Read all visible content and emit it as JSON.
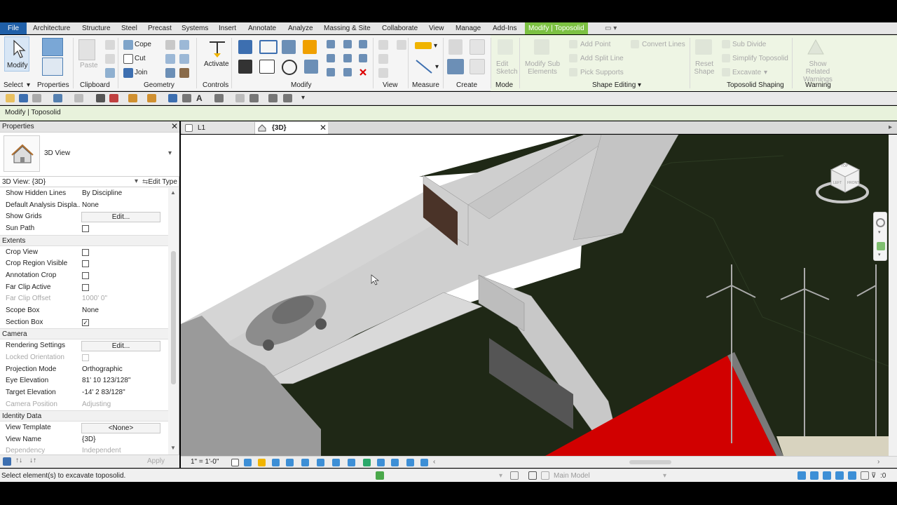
{
  "tabs": [
    "File",
    "Architecture",
    "Structure",
    "Steel",
    "Precast",
    "Systems",
    "Insert",
    "Annotate",
    "Analyze",
    "Massing & Site",
    "Collaborate",
    "View",
    "Manage",
    "Add-Ins",
    "Modify | Toposolid"
  ],
  "ribbon": {
    "modify_label": "Modify",
    "select_label": "Select",
    "properties_label": "Properties",
    "clipboard_label": "Clipboard",
    "paste_label": "Paste",
    "cope_label": "Cope",
    "cut_label": "Cut",
    "join_label": "Join",
    "geometry_label": "Geometry",
    "activate_label": "Activate",
    "controls_label": "Controls",
    "modify_panel_label": "Modify",
    "view_label": "View",
    "measure_label": "Measure",
    "create_label": "Create",
    "mode_label": "Mode",
    "edit_sketch_label": "Edit Sketch",
    "modify_sub_label": "Modify Sub Elements",
    "add_point_label": "Add Point",
    "add_split_line_label": "Add Split Line",
    "pick_supports_label": "Pick Supports",
    "convert_lines_label": "Convert Lines",
    "shape_editing_label": "Shape Editing",
    "reset_shape_label": "Reset Shape",
    "sub_divide_label": "Sub Divide",
    "simplify_label": "Simplify Toposolid",
    "excavate_label": "Excavate",
    "toposolid_shaping_label": "Toposolid Shaping",
    "show_warnings_label": "Show Related Warnings",
    "warning_label": "Warning"
  },
  "option_bar": "Modify | Toposolid",
  "properties": {
    "title": "Properties",
    "type_name": "3D View",
    "filter_label": "3D View: {3D}",
    "edit_type": "Edit Type",
    "apply": "Apply",
    "rows": [
      {
        "k": "Show Hidden Lines",
        "v": "By Discipline"
      },
      {
        "k": "Default Analysis Displa...",
        "v": "None"
      },
      {
        "k": "Show Grids",
        "btn": "Edit..."
      },
      {
        "k": "Sun Path",
        "cb": ""
      }
    ],
    "extents_label": "Extents",
    "extents": [
      {
        "k": "Crop View",
        "cb": ""
      },
      {
        "k": "Crop Region Visible",
        "cb": ""
      },
      {
        "k": "Annotation Crop",
        "cb": ""
      },
      {
        "k": "Far Clip Active",
        "cb": ""
      },
      {
        "k": "Far Clip Offset",
        "v": "1000'  0\""
      },
      {
        "k": "Scope Box",
        "v": "None"
      },
      {
        "k": "Section Box",
        "cb": "✓"
      }
    ],
    "camera_label": "Camera",
    "camera": [
      {
        "k": "Rendering Settings",
        "btn": "Edit..."
      },
      {
        "k": "Locked Orientation",
        "cb": ""
      },
      {
        "k": "Projection Mode",
        "v": "Orthographic"
      },
      {
        "k": "Eye Elevation",
        "v": "81'  10 123/128\""
      },
      {
        "k": "Target Elevation",
        "v": "-14'  2 83/128\""
      },
      {
        "k": "Camera Position",
        "v": "Adjusting"
      }
    ],
    "identity_label": "Identity Data",
    "identity": [
      {
        "k": "View Template",
        "btn": "<None>"
      },
      {
        "k": "View Name",
        "v": "{3D}"
      },
      {
        "k": "Dependency",
        "v": "Independent"
      }
    ]
  },
  "doc_tabs": [
    "L1",
    "{3D}"
  ],
  "view_control": {
    "scale": "1\" = 1'-0\""
  },
  "status": {
    "message": "Select element(s) to excavate toposolid.",
    "model": "Main Model",
    "filter_count": ":0"
  },
  "viewcube": {
    "top": "TOP",
    "front": "FRONT",
    "left": "LEFT"
  },
  "colors": {
    "accent": "#1f5fa8",
    "context": "#7cc142",
    "terrain": "#1f2816",
    "road": "#cfcfcf",
    "roof": "#d10000"
  }
}
